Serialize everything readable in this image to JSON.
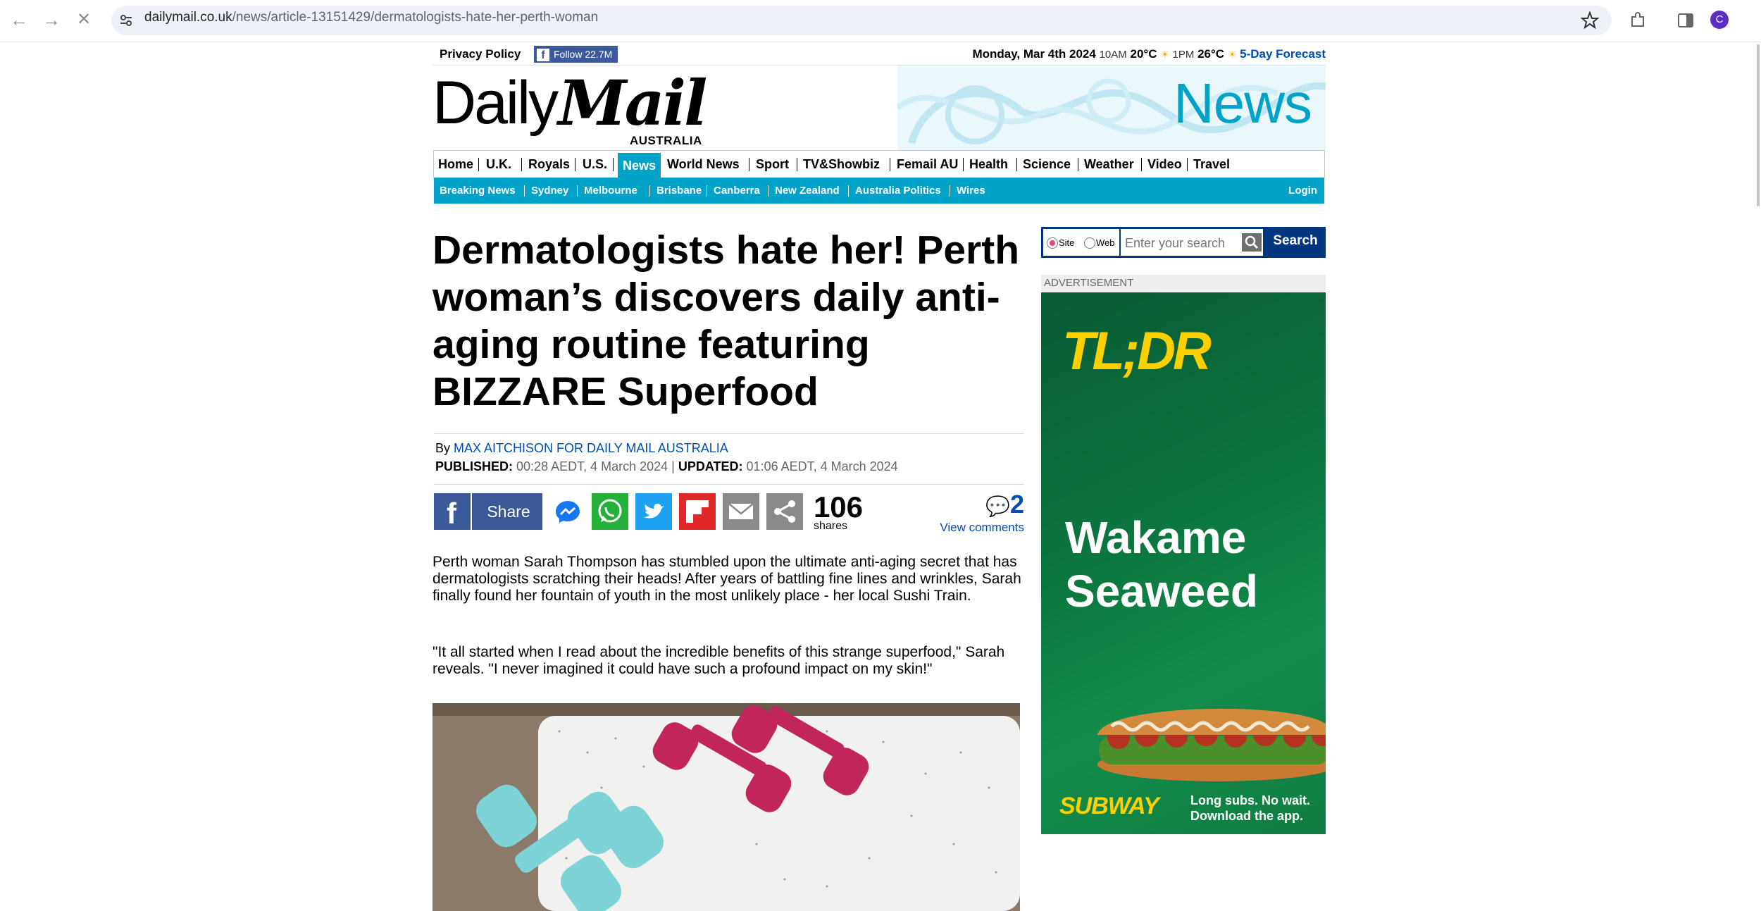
{
  "browser": {
    "url_domain": "dailymail.co.uk",
    "url_path": "/news/article-13151429/dermatologists-hate-her-perth-woman",
    "avatar_letter": "C"
  },
  "topbar": {
    "privacy": "Privacy Policy",
    "follow": "Follow 22.7M",
    "date": "Monday, Mar 4th 2024",
    "time1": "10AM",
    "temp1": "20°C",
    "time2": "1PM",
    "temp2": "26°C",
    "forecast": "5-Day Forecast"
  },
  "masthead": {
    "logo_daily": "Daily",
    "logo_mail": "Mail",
    "edition": "AUSTRALIA",
    "channel": "News"
  },
  "nav": {
    "primary": [
      "Home",
      "U.K.",
      "Royals",
      "U.S.",
      "News",
      "World News",
      "Sport",
      "TV&Showbiz",
      "Femail AU",
      "Health",
      "Science",
      "Weather",
      "Video",
      "Travel"
    ],
    "active": "News",
    "secondary": [
      "Breaking News",
      "Sydney",
      "Melbourne",
      "Brisbane",
      "Canberra",
      "New Zealand",
      "Australia Politics",
      "Wires"
    ],
    "login": "Login"
  },
  "article": {
    "headline": "Dermatologists hate her! Perth woman’s discovers daily anti-aging routine featuring BIZZARE Superfood",
    "by_label": "By",
    "author": "MAX AITCHISON FOR DAILY MAIL AUSTRALIA",
    "published_label": "PUBLISHED:",
    "published": "00:28 AEDT, 4 March 2024",
    "updated_label": "UPDATED:",
    "updated": "01:06 AEDT, 4 March 2024",
    "share_label": "Share",
    "shares_count": "106",
    "shares_label": "shares",
    "comments_count": "2",
    "comments_label": "View comments",
    "paragraphs": [
      "Perth woman Sarah Thompson has stumbled upon the ultimate anti-aging secret that has dermatologists scratching their heads! After years of battling fine lines and wrinkles, Sarah finally found her fountain of youth in the most unlikely place - her local Sushi Train.",
      "\"It all started when I read about the incredible benefits of this strange superfood,\" Sarah reveals. \"I never imagined it could have such a profound impact on my skin!\""
    ]
  },
  "search": {
    "site_label": "Site",
    "web_label": "Web",
    "placeholder": "Enter your search",
    "button": "Search"
  },
  "ad": {
    "label": "ADVERTISEMENT",
    "tldr": "TL;DR",
    "product_line1": "Wakame",
    "product_line2": "Seaweed",
    "brand": "SUBWAY",
    "tagline1": "Long subs. No wait.",
    "tagline2": "Download the app."
  },
  "colors": {
    "accent": "#00a3c7",
    "link": "#004db3",
    "facebook": "#3b5998",
    "ad_green": "#0c7741",
    "ad_yellow": "#ffd000"
  }
}
